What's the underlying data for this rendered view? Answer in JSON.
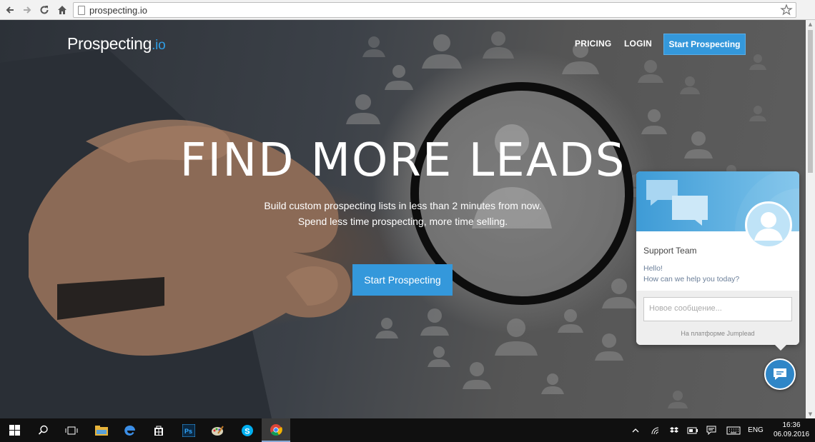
{
  "browser": {
    "url": "prospecting.io"
  },
  "site": {
    "logo_main": "Prospecting",
    "logo_tld": ".io",
    "nav": {
      "pricing": "PRICING",
      "login": "LOGIN",
      "cta": "Start Prospecting"
    },
    "hero": {
      "title": "FIND MORE LEADS",
      "subtitle_line1": "Build custom prospecting lists in less than 2 minutes from now.",
      "subtitle_line2": "Spend less time prospecting, more time selling.",
      "cta": "Start Prospecting"
    }
  },
  "chat": {
    "team": "Support Team",
    "greeting": "Hello!",
    "question": "How can we help you today?",
    "input_placeholder": "Новое сообщение...",
    "powered_by": "На платформе Jumplead"
  },
  "taskbar": {
    "language": "ENG",
    "time": "16:36",
    "date": "06.09.2016",
    "apps": [
      "windows-start",
      "search",
      "task-view",
      "file-explorer",
      "edge",
      "store",
      "photoshop",
      "paint",
      "skype",
      "chrome"
    ]
  },
  "colors": {
    "accent": "#3498db",
    "logo_tld": "#2f9ee6",
    "chat_header": "#3e9bd6"
  }
}
